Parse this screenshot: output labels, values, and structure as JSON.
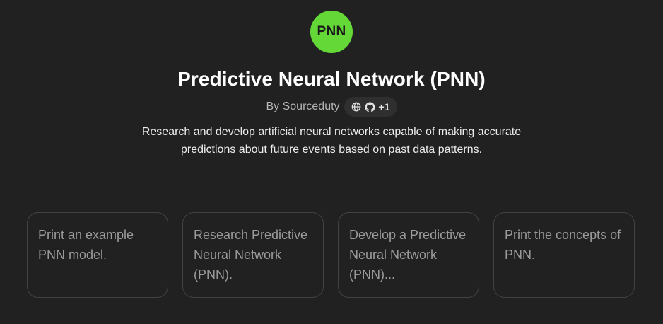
{
  "gpt": {
    "avatar_text": "PNN",
    "avatar_color": "#64d836",
    "title": "Predictive Neural Network (PNN)",
    "byline": "By Sourceduty",
    "links": {
      "icons": [
        "globe-icon",
        "github-icon"
      ],
      "extra_count": "+1"
    },
    "description": "Research and develop artificial neural networks capable of making accurate predictions about future events based on past data patterns."
  },
  "conversation_starters": [
    {
      "label": "Print an example PNN model."
    },
    {
      "label": "Research Predictive Neural Network (PNN)."
    },
    {
      "label": "Develop a Predictive Neural Network (PNN)..."
    },
    {
      "label": "Print the concepts of PNN."
    }
  ]
}
